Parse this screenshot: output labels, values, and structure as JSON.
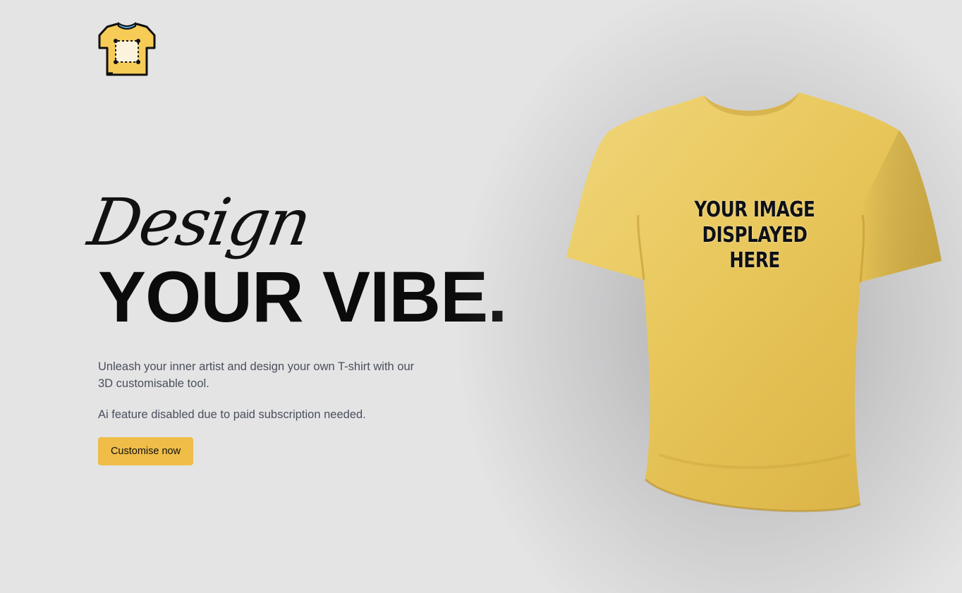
{
  "brand": {
    "logo_icon": "tshirt-design-icon",
    "colors": {
      "shirt": "#e9c45b",
      "accent": "#efbd48",
      "collar": "#5aa8d6"
    }
  },
  "hero": {
    "script_title": "Design",
    "bold_title": "YOUR VIBE.",
    "description": "Unleash your inner artist and design your own T-shirt with our 3D customisable tool.",
    "note": "Ai feature disabled due to paid subscription needed.",
    "cta_label": "Customise now"
  },
  "preview": {
    "shirt_icon": "tshirt-3d-preview",
    "placeholder_lines": [
      "YOUR IMAGE",
      "DISPLAYED",
      "HERE"
    ]
  }
}
